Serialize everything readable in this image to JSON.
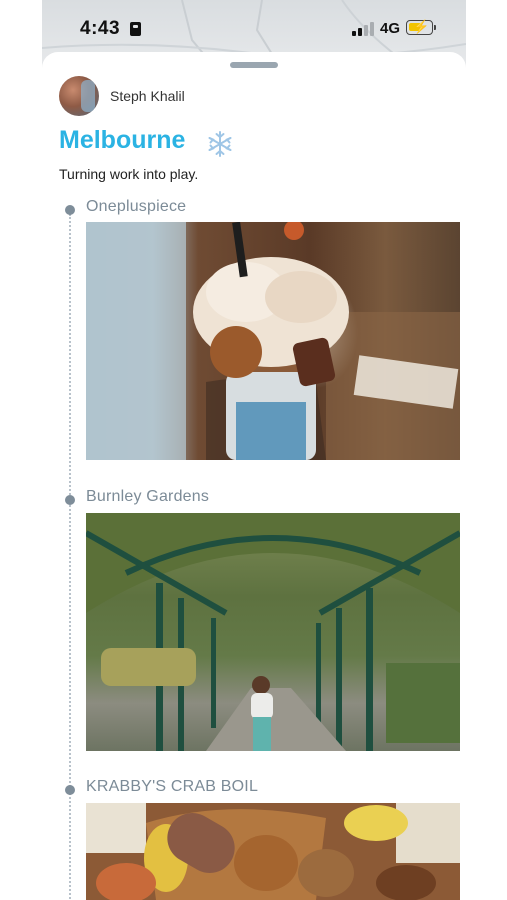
{
  "status_bar": {
    "time": "4:43",
    "network": "4G",
    "battery_level": 0.6,
    "battery_color": "#f2c400"
  },
  "trip": {
    "author": "Steph Khalil",
    "title": "Melbourne",
    "title_icon": "snowflake-icon",
    "title_color": "#2bb3e3",
    "subtitle": "Turning work into play."
  },
  "stops": [
    {
      "name": "Oneplusp﻿iece",
      "photo_icon": "milkshake-photo"
    },
    {
      "name": "Burnley Gardens",
      "photo_icon": "garden-walkway-photo"
    },
    {
      "name": "KRABBY'S CRAB BOIL",
      "photo_icon": "crab-boil-photo"
    }
  ]
}
